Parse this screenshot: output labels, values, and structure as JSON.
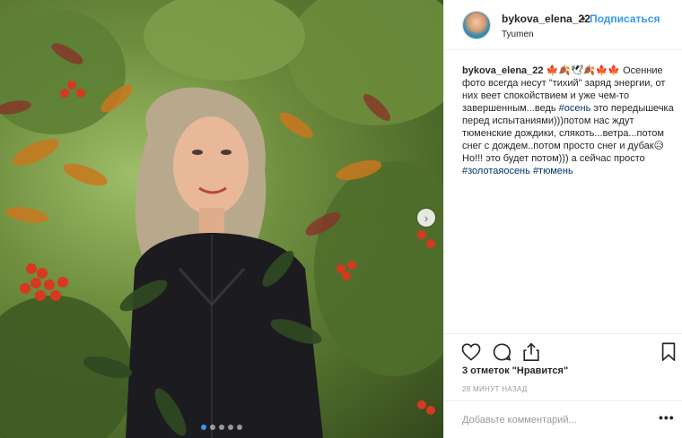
{
  "post": {
    "username": "bykova_elena_22",
    "separator": "•",
    "follow_label": "Подписаться",
    "location": "Tyumen"
  },
  "caption": {
    "user": "bykova_elena_22",
    "emoji": "🍁🍂🕊🍂🍁🍁",
    "text_part1": "Осенние фото всегда несут \"тихий\" заряд энергии, от них веет спокойствием и уже чем-то завершенным...ведь ",
    "hashtag1": "#осень",
    "text_part2": " это передышечка перед испытаниями)))потом нас ждут тюменские дождики, слякоть...ветра...потом снег с дождем..потом просто снег и дубак😥\nНо!!! это будет потом))) а сейчас просто ",
    "hashtag2": "#золотаяосень",
    "hashtag3": "#тюмень"
  },
  "stats": {
    "likes_count": "3 отметок",
    "likes_label": "\"Нравится\"",
    "time_ago": "28 МИНУТ НАЗАД"
  },
  "comment": {
    "placeholder": "Добавьте комментарий...",
    "more_label": "•••"
  },
  "carousel": {
    "next_glyph": "›",
    "slides": 5,
    "active_index": 1
  },
  "icons": {
    "like": "heart-icon",
    "comment": "comment-icon",
    "share": "share-icon",
    "save": "bookmark-icon"
  },
  "colors": {
    "link_blue": "#3897f0",
    "hashtag": "#003569",
    "muted": "#999999"
  }
}
